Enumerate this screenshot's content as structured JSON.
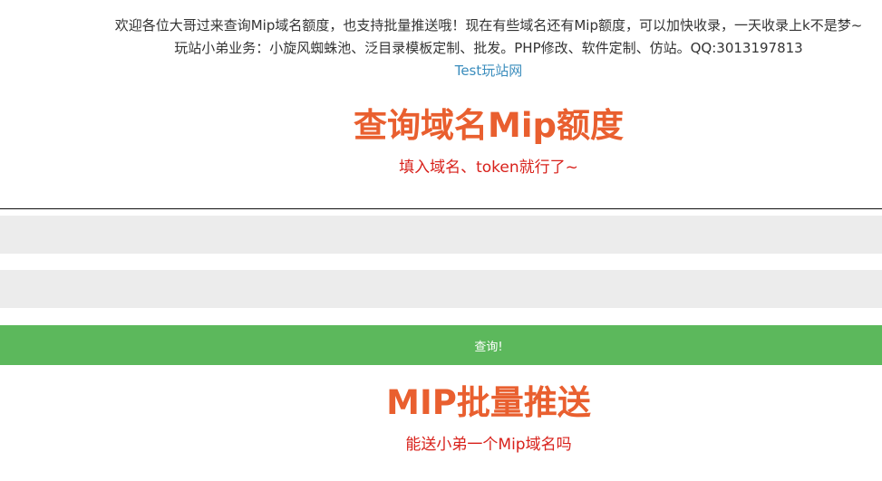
{
  "notice": {
    "line1": "欢迎各位大哥过来查询Mip域名额度，也支持批量推送哦！现在有些域名还有Mip额度，可以加快收录，一天收录上k不是梦~",
    "line2": "玩站小弟业务：小旋风蜘蛛池、泛目录模板定制、批发。PHP修改、软件定制、仿站。QQ:3013197813"
  },
  "site_link": "Test玩站网",
  "query_section": {
    "title": "查询域名Mip额度",
    "subtitle": "填入域名、token就行了~",
    "domain_field": {
      "value": "",
      "placeholder": ""
    },
    "token_field": {
      "value": "",
      "placeholder": ""
    },
    "submit_label": "查询!"
  },
  "push_section": {
    "title": "MIP批量推送",
    "subtitle": "能送小弟一个Mip域名吗"
  },
  "colors": {
    "title": "#e95f2f",
    "subtitle": "#d8211b",
    "link": "#3b8dbd",
    "button": "#5cb85c",
    "field_bg": "#ececec"
  }
}
